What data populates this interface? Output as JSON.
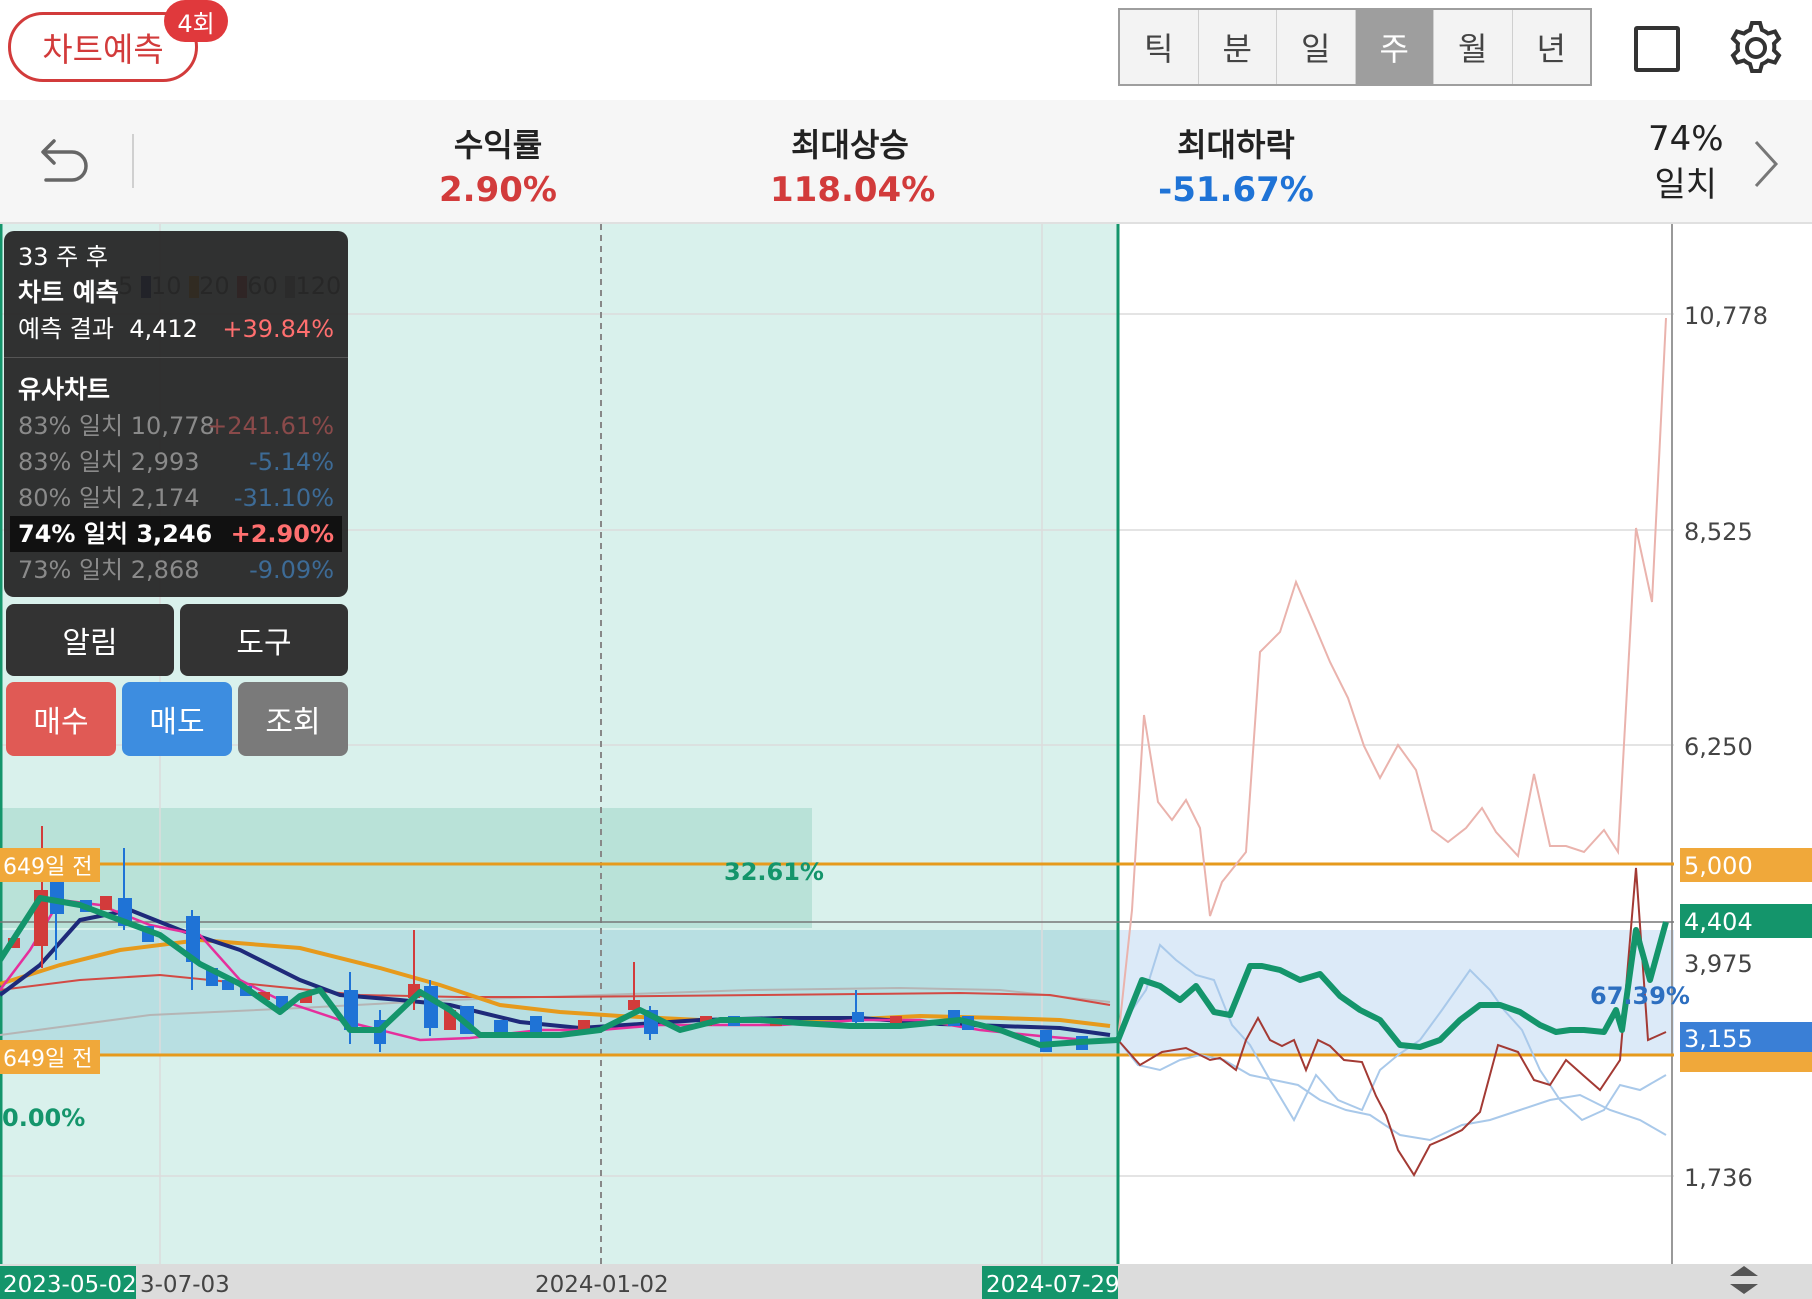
{
  "header": {
    "predict_label": "차트예측",
    "predict_count": "4회",
    "periods": [
      "틱",
      "분",
      "일",
      "주",
      "월",
      "년"
    ],
    "active_period": "주"
  },
  "stats": {
    "return_label": "수익률",
    "return_value": "2.90%",
    "max_up_label": "최대상승",
    "max_up_value": "118.04%",
    "max_down_label": "최대하락",
    "max_down_value": "-51.67%",
    "match_pct": "74%",
    "match_label": "일치"
  },
  "tooltip": {
    "weeks_after": "33 주 후",
    "predict_title": "차트 예측",
    "result_label": "예측 결과",
    "result_value": "4,412",
    "result_change": "+39.84%",
    "similar_title": "유사차트",
    "items": [
      {
        "match": "83% 일치",
        "value": "10,778",
        "change": "+241.61%"
      },
      {
        "match": "83% 일치",
        "value": "2,993",
        "change": "-5.14%"
      },
      {
        "match": "80% 일치",
        "value": "2,174",
        "change": "-31.10%"
      },
      {
        "match": "74% 일치",
        "value": "3,246",
        "change": "+2.90%"
      },
      {
        "match": "73% 일치",
        "value": "2,868",
        "change": "-9.09%"
      }
    ]
  },
  "buttons": {
    "alarm": "알림",
    "tools": "도구",
    "buy": "매수",
    "sell": "매도",
    "inquiry": "조회"
  },
  "chart": {
    "y_labels": [
      "10,778",
      "8,525",
      "6,250",
      "3,975",
      "1,736"
    ],
    "hl_upper": "5,000",
    "hl_current": "4,404",
    "hl_lower": "3,155",
    "days_before_top": "649일 전",
    "days_before_bottom": "649일 전",
    "zone_pct": "32.61%",
    "pred_pct": "67.39%",
    "left_pct": "0.00%",
    "x_labels": [
      "2023-05-02",
      "3-07-03",
      "2024-01-02",
      "2024-07-29"
    ],
    "ma_legend": [
      "5",
      "10",
      "20",
      "60",
      "120"
    ],
    "colors": {
      "up": "#d23b3b",
      "down": "#1f73d6",
      "prediction": "#14956b",
      "ma_orange": "#e69a1c"
    }
  }
}
